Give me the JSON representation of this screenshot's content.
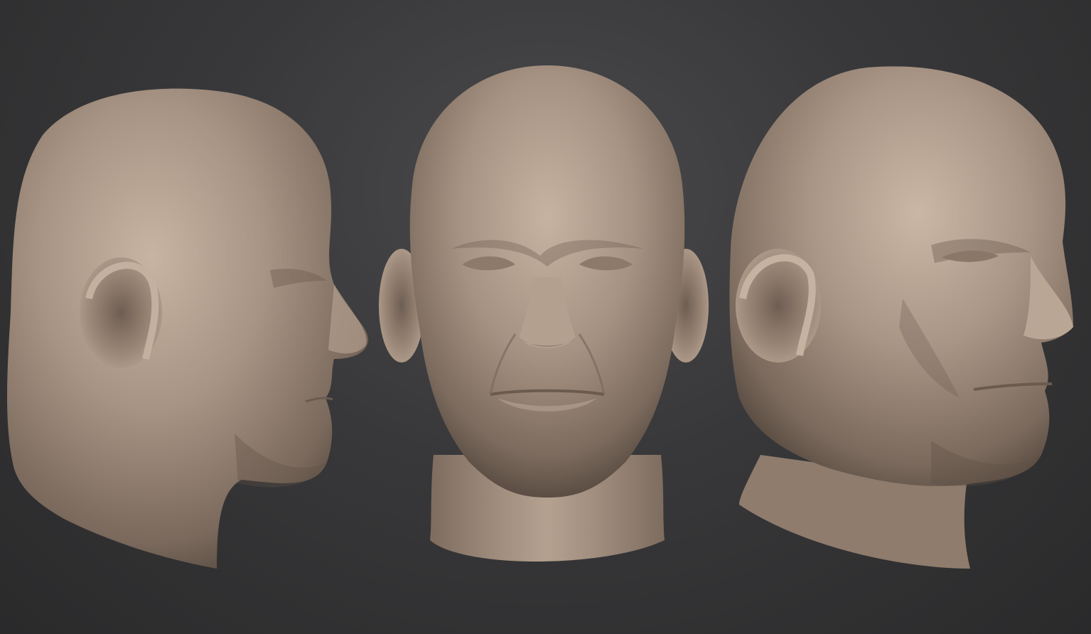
{
  "scene": {
    "background_color": "#3a3a3c",
    "material_color": "#a89484",
    "views": [
      {
        "name": "left-profile-view"
      },
      {
        "name": "front-view"
      },
      {
        "name": "right-three-quarter-view"
      }
    ]
  }
}
